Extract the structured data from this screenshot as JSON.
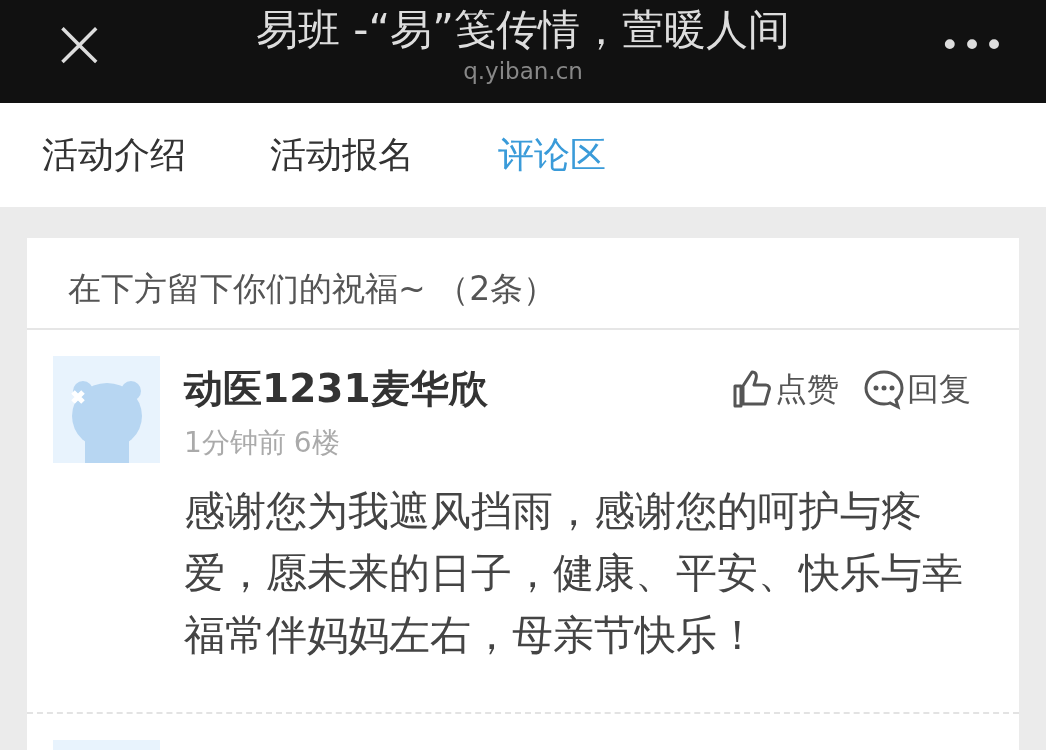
{
  "window": {
    "close": "×",
    "title": "易班 -“易”笺传情，萱暖人间",
    "url": "q.yiban.cn",
    "more": "•••"
  },
  "tabs": [
    {
      "label": "活动介绍",
      "selected": false
    },
    {
      "label": "活动报名",
      "selected": false
    },
    {
      "label": "评论区",
      "selected": true
    }
  ],
  "comments_header": "在下方留下你们的祝福~ （2条）",
  "comments": [
    {
      "kind": "full",
      "name": "动医1231麦华欣",
      "like": "点赞",
      "reply": "回复",
      "time": "1分钟前",
      "floor": "6楼",
      "text": "感谢您为我遮风挡雨，感谢您的呵护与疼爱，愿未来的日子，健康、平安、快乐与幸福常伴妈妈左右，母亲节快乐！"
    },
    {
      "kind": "avatar_only"
    }
  ]
}
